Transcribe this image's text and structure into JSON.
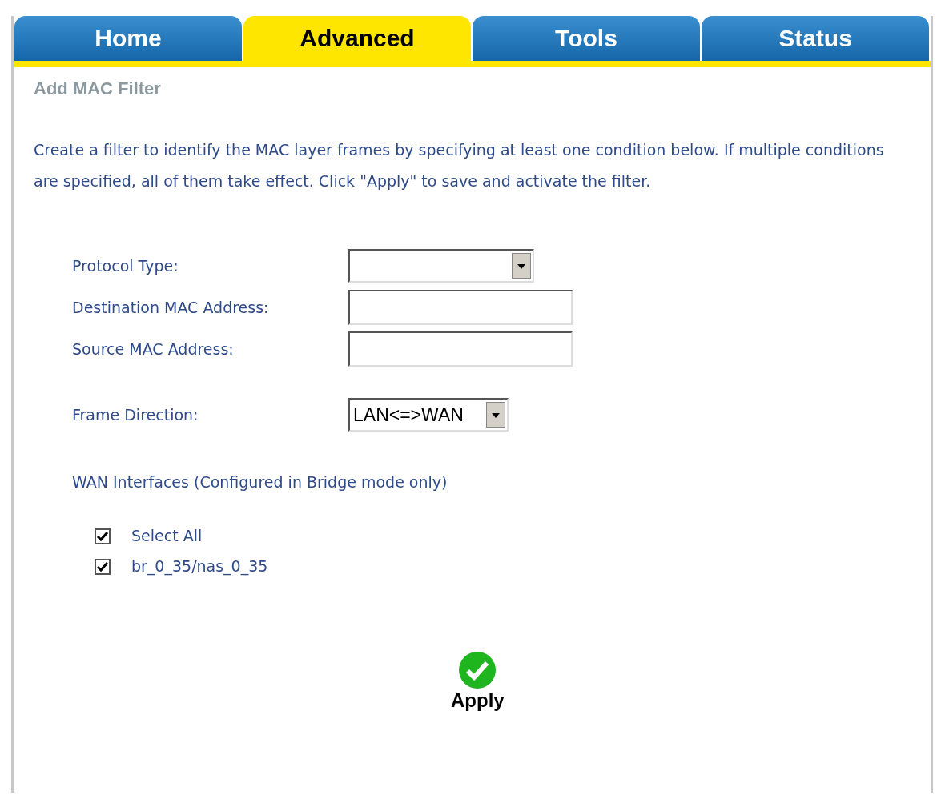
{
  "tabs": [
    {
      "label": "Home",
      "selected": false
    },
    {
      "label": "Advanced",
      "selected": true
    },
    {
      "label": "Tools",
      "selected": false
    },
    {
      "label": "Status",
      "selected": false
    }
  ],
  "page_title": "Add MAC Filter",
  "description": "Create a filter to identify the MAC layer frames by specifying at least one condition below. If multiple conditions are specified, all of them take effect. Click \"Apply\" to save and activate the filter.",
  "fields": [
    {
      "label": "Protocol Type:",
      "kind": "select"
    },
    {
      "label": "Destination MAC Address:",
      "kind": "text"
    },
    {
      "label": "Source MAC Address:",
      "kind": "text"
    },
    {
      "label": "Frame Direction:",
      "kind": "select",
      "value": "LAN<=>WAN"
    }
  ],
  "wan_label": "WAN Interfaces (Configured in Bridge mode only)",
  "interfaces": [
    {
      "label": "Select All",
      "checked": true
    },
    {
      "label": "br_0_35/nas_0_35",
      "checked": true
    }
  ],
  "apply_button": "Apply"
}
